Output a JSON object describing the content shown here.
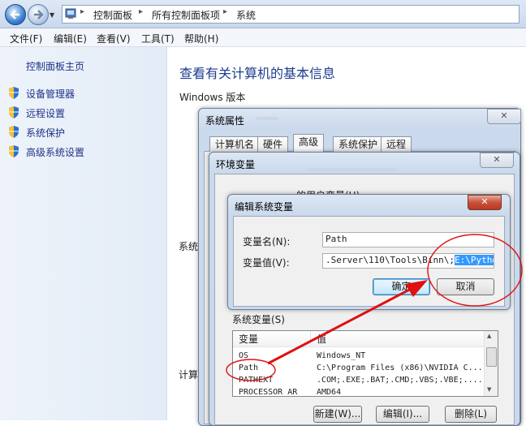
{
  "explorer": {
    "breadcrumb": [
      "控制面板",
      "所有控制面板项",
      "系统"
    ],
    "menu": [
      "文件(F)",
      "编辑(E)",
      "查看(V)",
      "工具(T)",
      "帮助(H)"
    ],
    "left_panel": {
      "home": "控制面板主页",
      "links": [
        "设备管理器",
        "远程设置",
        "系统保护",
        "高级系统设置"
      ]
    },
    "main": {
      "title": "查看有关计算机的基本信息",
      "windows_edition": "Windows 版本",
      "system_label": "系统",
      "computer_label": "计算"
    }
  },
  "sys_props": {
    "title": "系统属性",
    "tabs": [
      "计算机名",
      "硬件",
      "高级",
      "系统保护",
      "远程"
    ],
    "active_tab": "高级",
    "close": "✕"
  },
  "env_vars": {
    "title": "环境变量",
    "user_vars_partial": "的用户变量(U)",
    "close": "✕",
    "system_vars_label": "系统变量(S)",
    "columns": [
      "变量",
      "值"
    ],
    "rows": [
      {
        "name": "OS",
        "value": "Windows_NT"
      },
      {
        "name": "Path",
        "value": "C:\\Program Files (x86)\\NVIDIA C..."
      },
      {
        "name": "PATHEXT",
        "value": ".COM;.EXE;.BAT;.CMD;.VBS;.VBE;...."
      },
      {
        "name": "PROCESSOR_AR",
        "value": "AMD64"
      }
    ],
    "buttons": {
      "new": "新建(W)...",
      "edit": "编辑(I)...",
      "delete": "删除(L)"
    }
  },
  "edit_dialog": {
    "title": "编辑系统变量",
    "close": "✕",
    "name_label": "变量名(N):",
    "name_value": "Path",
    "value_label": "变量值(V):",
    "value_text": ".Server\\110\\Tools\\Binn\\;",
    "value_selected": "E:\\Python27",
    "ok": "确定",
    "cancel": "取消"
  },
  "annotation_color": "#e01010",
  "icons": [
    "back-arrow-icon",
    "forward-arrow-icon",
    "control-panel-icon",
    "uac-shield-icon"
  ]
}
